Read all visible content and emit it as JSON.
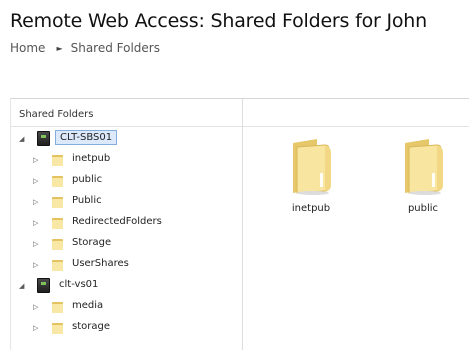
{
  "page": {
    "title": "Remote Web Access: Shared Folders for John"
  },
  "breadcrumb": {
    "home": "Home",
    "separator": "►",
    "current": "Shared Folders"
  },
  "tree": {
    "header": "Shared Folders",
    "servers": [
      {
        "name": "CLT-SBS01",
        "expander": "◢",
        "selected": true,
        "folders": [
          "inetpub",
          "public",
          "Public",
          "RedirectedFolders",
          "Storage",
          "UserShares"
        ]
      },
      {
        "name": "clt-vs01",
        "expander": "◢",
        "selected": false,
        "folders": [
          "media",
          "storage"
        ]
      }
    ],
    "folder_expander": "▷"
  },
  "content": {
    "items": [
      "inetpub",
      "public"
    ]
  },
  "colors": {
    "folder_light": "#f9e7a6",
    "folder_dark": "#e3c25f",
    "selection_bg": "#dbe9fb",
    "selection_border": "#84acdd"
  }
}
